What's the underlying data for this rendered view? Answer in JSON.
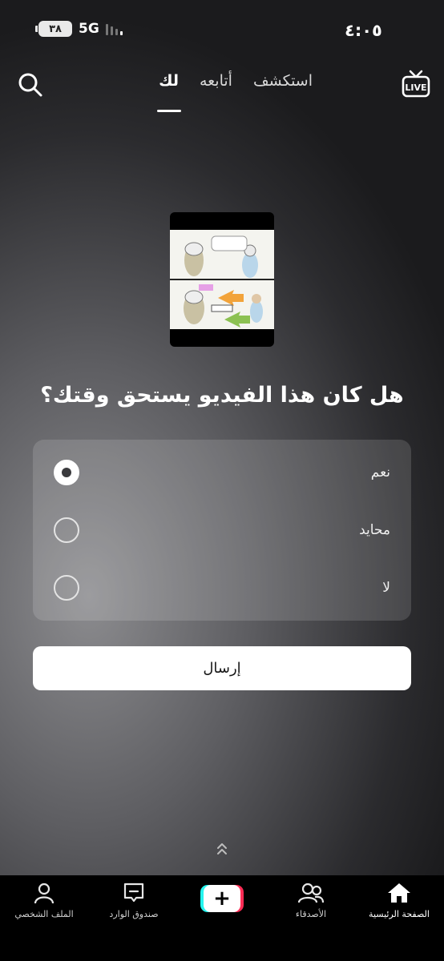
{
  "status_bar": {
    "time": "٤:٠٥",
    "battery": "٣٨",
    "network": "5G"
  },
  "top_nav": {
    "tabs": [
      {
        "label": "استكشف",
        "active": false
      },
      {
        "label": "أتابعه",
        "active": false
      },
      {
        "label": "لك",
        "active": true
      }
    ],
    "live_label": "LIVE"
  },
  "survey": {
    "question": "هل كان هذا الفيديو يستحق وقتك؟",
    "options": [
      {
        "label": "نعم",
        "selected": true
      },
      {
        "label": "محايد",
        "selected": false
      },
      {
        "label": "لا",
        "selected": false
      }
    ],
    "submit_label": "إرسال"
  },
  "bottom_nav": {
    "items": [
      {
        "label": "الصفحة الرئيسية",
        "icon": "home-icon",
        "active": true
      },
      {
        "label": "الأصدقاء",
        "icon": "friends-icon",
        "active": false
      },
      {
        "label": "+",
        "icon": "create-icon",
        "active": false
      },
      {
        "label": "صندوق الوارد",
        "icon": "inbox-icon",
        "active": false
      },
      {
        "label": "الملف الشخصي",
        "icon": "profile-icon",
        "active": false
      }
    ]
  },
  "colors": {
    "accent_cyan": "#25f4ee",
    "accent_red": "#fe2c55",
    "nav_background": "#000000",
    "submit_background": "#ffffff"
  }
}
